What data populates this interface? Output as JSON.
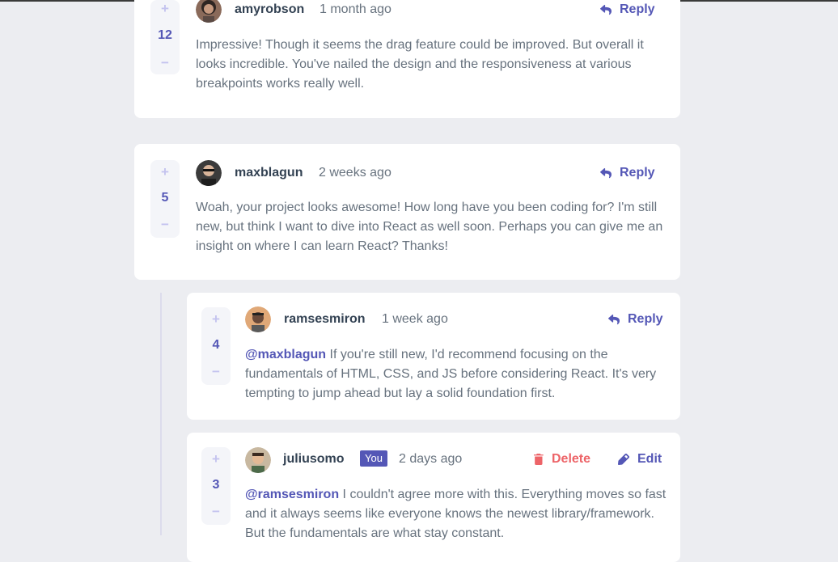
{
  "comments": [
    {
      "score": "12",
      "username": "amyrobson",
      "time": "1 month ago",
      "action_label": "Reply",
      "text": "Impressive! Though it seems the drag feature could be improved. But overall it looks incredible. You've nailed the design and the responsiveness at various breakpoints works really well."
    },
    {
      "score": "5",
      "username": "maxblagun",
      "time": "2 weeks ago",
      "action_label": "Reply",
      "text": "Woah, your project looks awesome! How long have you been coding for? I'm still new, but think I want to dive into React as well soon. Perhaps you can give me an insight on where I can learn React? Thanks!"
    }
  ],
  "replies": [
    {
      "score": "4",
      "username": "ramsesmiron",
      "time": "1 week ago",
      "action_label": "Reply",
      "mention": "@maxblagun",
      "text": "If you're still new, I'd recommend focusing on the fundamentals of HTML, CSS, and JS before considering React. It's very tempting to jump ahead but lay a solid foundation first."
    },
    {
      "score": "3",
      "username": "juliusomo",
      "you_badge": "You",
      "time": "2 days ago",
      "delete_label": "Delete",
      "edit_label": "Edit",
      "mention": "@ramsesmiron",
      "text": "I couldn't agree more with this. Everything moves so fast and it always seems like everyone knows the newest library/framework. But the fundamentals are what stay constant."
    }
  ],
  "vote": {
    "plus": "+",
    "minus": "−"
  },
  "colors": {
    "primary": "#5457b6",
    "danger": "#ed6468",
    "background": "#ecedf1"
  },
  "icons": {
    "reply": "reply-icon",
    "delete": "trash-icon",
    "edit": "pencil-icon"
  }
}
